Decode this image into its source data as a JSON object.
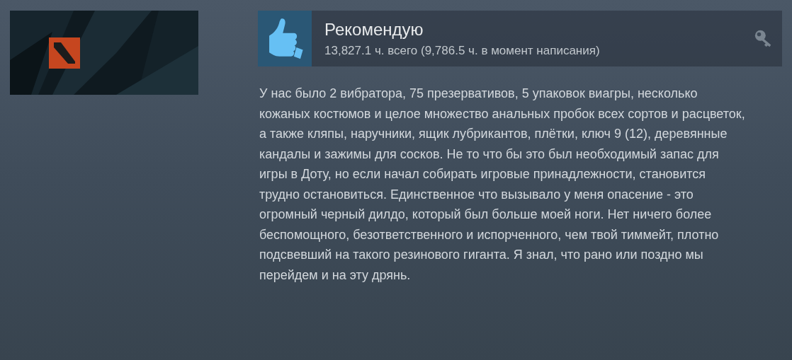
{
  "review": {
    "recommended": true,
    "title": "Рекомендую",
    "hours": "13,827.1 ч. всего (9,786.5 ч. в момент написания)",
    "product_key": true,
    "body": "У нас было 2 вибратора, 75 презервативов, 5 упаковок виагры, несколько кожаных костюмов и целое множество анальных пробок всех сортов и расцветок, а также кляпы, наручники, ящик лубрикантов, плётки, ключ 9 (12), деревянные кандалы и зажимы для сосков. Не то что бы это был необходимый запас для игры в Доту, но если начал собирать игровые принадлежности, становится трудно остановиться. Единственное что вызывало у меня опасение - это огромный черный дилдо, который был больше моей ноги. Нет ничего более беспомощного, безответственного и испорченного, чем твой тиммейт, плотно подсвевший на такого резинового гиганта. Я знал, что рано или поздно мы перейдем и на эту дрянь."
  }
}
